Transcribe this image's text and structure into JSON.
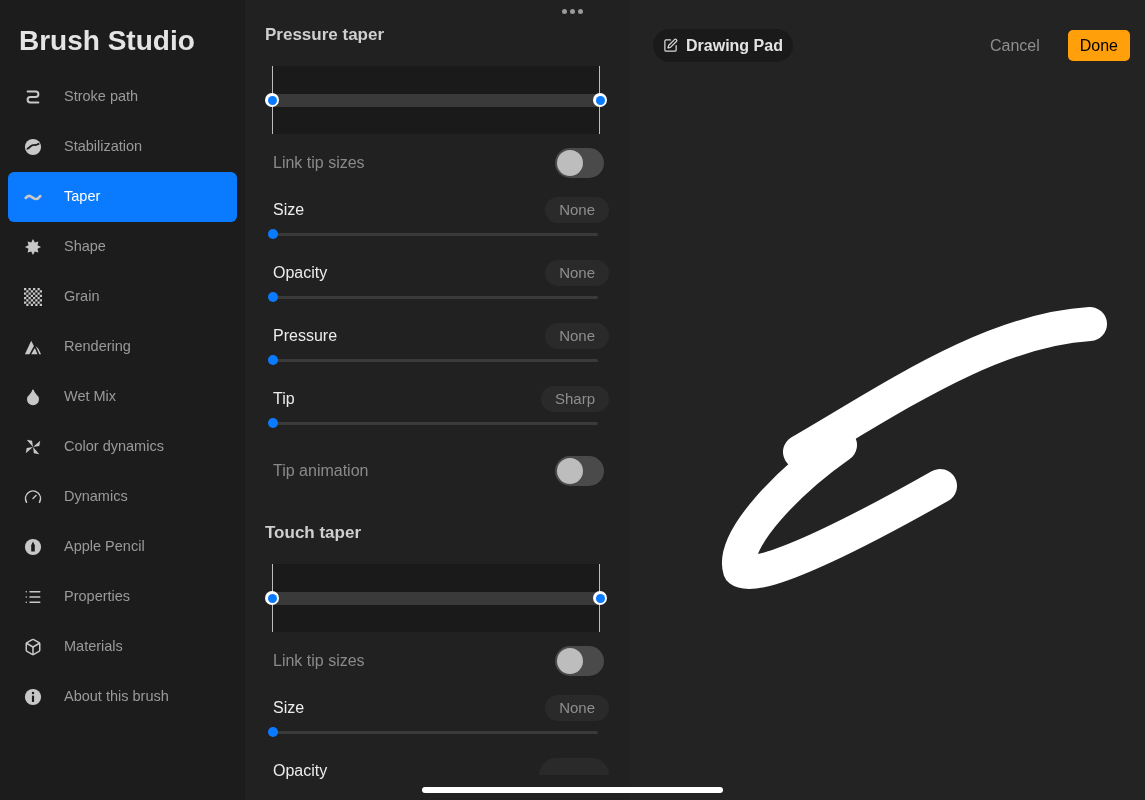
{
  "sidebar": {
    "title": "Brush Studio",
    "items": [
      {
        "label": "Stroke path",
        "selected": false
      },
      {
        "label": "Stabilization",
        "selected": false
      },
      {
        "label": "Taper",
        "selected": true
      },
      {
        "label": "Shape",
        "selected": false
      },
      {
        "label": "Grain",
        "selected": false
      },
      {
        "label": "Rendering",
        "selected": false
      },
      {
        "label": "Wet Mix",
        "selected": false
      },
      {
        "label": "Color dynamics",
        "selected": false
      },
      {
        "label": "Dynamics",
        "selected": false
      },
      {
        "label": "Apple Pencil",
        "selected": false
      },
      {
        "label": "Properties",
        "selected": false
      },
      {
        "label": "Materials",
        "selected": false
      },
      {
        "label": "About this brush",
        "selected": false
      }
    ]
  },
  "settings": {
    "sections": [
      {
        "title": "Pressure taper",
        "rows": [
          {
            "kind": "toggle",
            "label": "Link tip sizes",
            "on": false,
            "disabled": true
          },
          {
            "kind": "slider",
            "label": "Size",
            "value": "None",
            "level": 0
          },
          {
            "kind": "slider",
            "label": "Opacity",
            "value": "None",
            "level": 0
          },
          {
            "kind": "slider",
            "label": "Pressure",
            "value": "None",
            "level": 0
          },
          {
            "kind": "slider",
            "label": "Tip",
            "value": "Sharp",
            "level": 0
          },
          {
            "kind": "toggle",
            "label": "Tip animation",
            "on": false,
            "disabled": true
          }
        ]
      },
      {
        "title": "Touch taper",
        "rows": [
          {
            "kind": "toggle",
            "label": "Link tip sizes",
            "on": false,
            "disabled": true
          },
          {
            "kind": "slider",
            "label": "Size",
            "value": "None",
            "level": 0
          },
          {
            "kind": "slider",
            "label": "Opacity"
          }
        ]
      }
    ]
  },
  "drawing_pad": {
    "title": "Drawing Pad",
    "buttons": [
      "Cancel",
      "Done"
    ]
  }
}
